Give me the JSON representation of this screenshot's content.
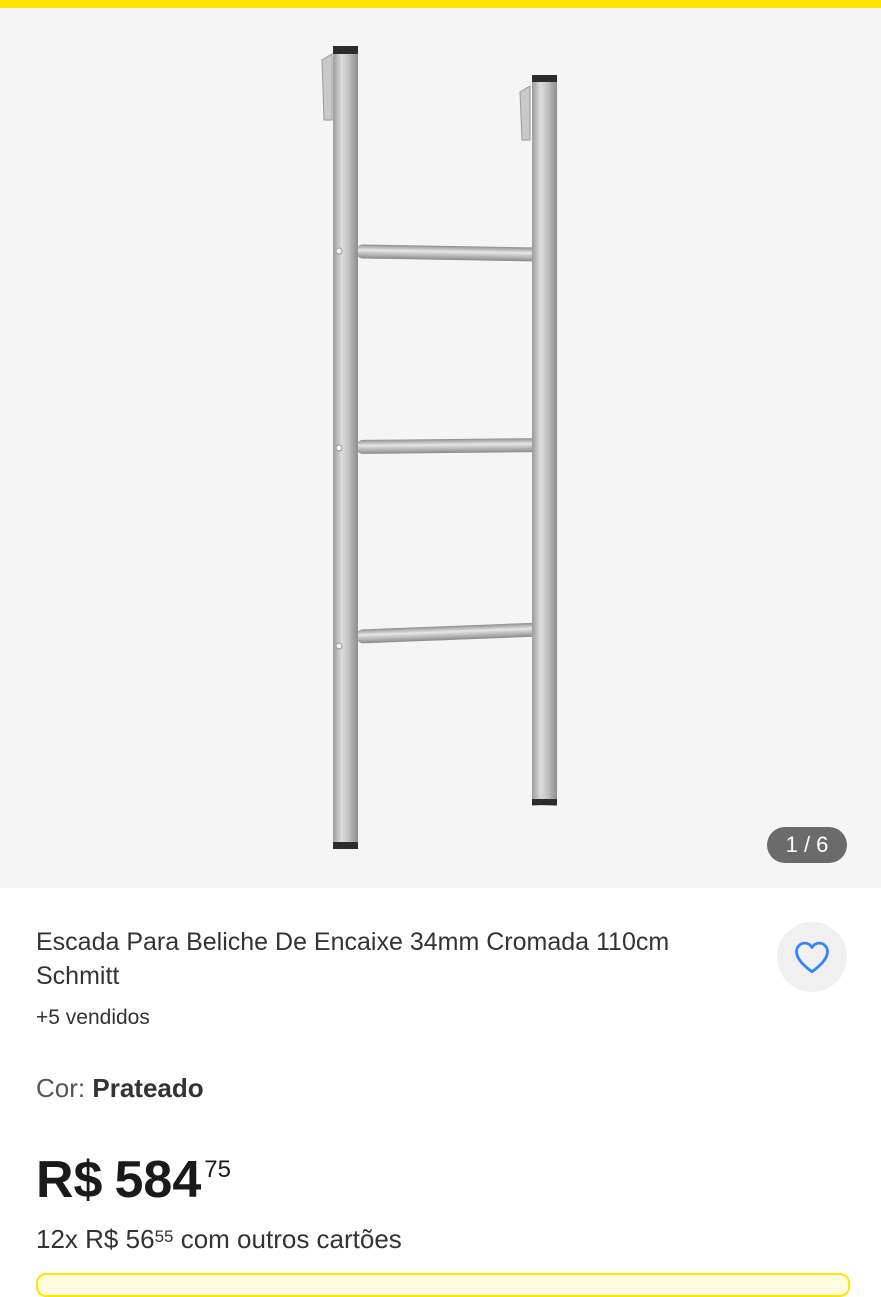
{
  "gallery": {
    "image_alt": "Escada Para Beliche De Encaixe 34mm Cromada 110cm Schmitt",
    "counter": "1 / 6"
  },
  "product": {
    "title": "Escada Para Beliche De Encaixe 34mm Cromada 110cm Schmitt",
    "sold": "+5 vendidos",
    "color_label": "Cor:",
    "color_value": "Prateado"
  },
  "price": {
    "currency": "R$",
    "integer": "584",
    "cents": "75"
  },
  "installments": {
    "count": "12x",
    "currency": "R$",
    "integer": "56",
    "cents": "55",
    "suffix": "com outros cartões"
  },
  "icons": {
    "favorite": "heart-icon"
  },
  "colors": {
    "accent": "#ffe600",
    "favorite": "#3483fa",
    "counter_bg": "#6b6b6b"
  }
}
